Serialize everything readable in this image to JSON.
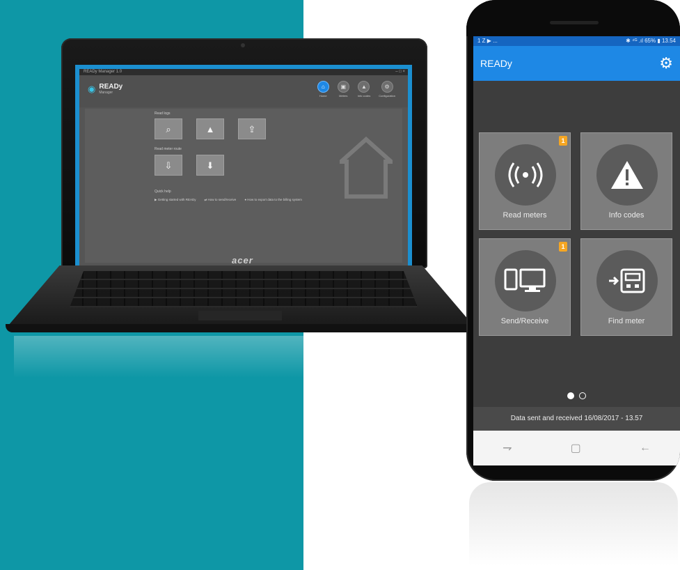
{
  "laptop": {
    "window_title": "READy Manager 1.0",
    "window_buttons": "–  □  ×",
    "logo_title": "READy",
    "logo_subtitle": "Manager",
    "nav": [
      {
        "label": "Home",
        "icon": "home-icon",
        "active": true
      },
      {
        "label": "Meters",
        "icon": "meter-icon",
        "active": false
      },
      {
        "label": "Info codes",
        "icon": "warning-icon",
        "active": false
      },
      {
        "label": "Configuration",
        "icon": "lock-icon",
        "active": false
      }
    ],
    "section_1": "Read logs",
    "section_2": "Read meter route",
    "section_3": "Quick help",
    "footer_links": [
      "Getting started with READy",
      "How to send/receive",
      "How to export data to the billing system"
    ],
    "brand": "acer"
  },
  "phone": {
    "status_left": "1 Z ▶ ...",
    "status_right": "✱ ⁴ᴳ .ıl 65% ▮ 13.54",
    "app_title": "READy",
    "tiles": [
      {
        "label": "Read meters",
        "icon": "radio-signal-icon",
        "badge": "1"
      },
      {
        "label": "Info codes",
        "icon": "warning-icon",
        "badge": ""
      },
      {
        "label": "Send/Receive",
        "icon": "devices-icon",
        "badge": "1"
      },
      {
        "label": "Find meter",
        "icon": "find-meter-icon",
        "badge": ""
      }
    ],
    "page_indicator": {
      "current": 1,
      "total": 2
    },
    "status_message": "Data sent and received 16/08/2017 - 13.57",
    "nav_buttons": [
      "recent-apps",
      "home",
      "back"
    ]
  }
}
